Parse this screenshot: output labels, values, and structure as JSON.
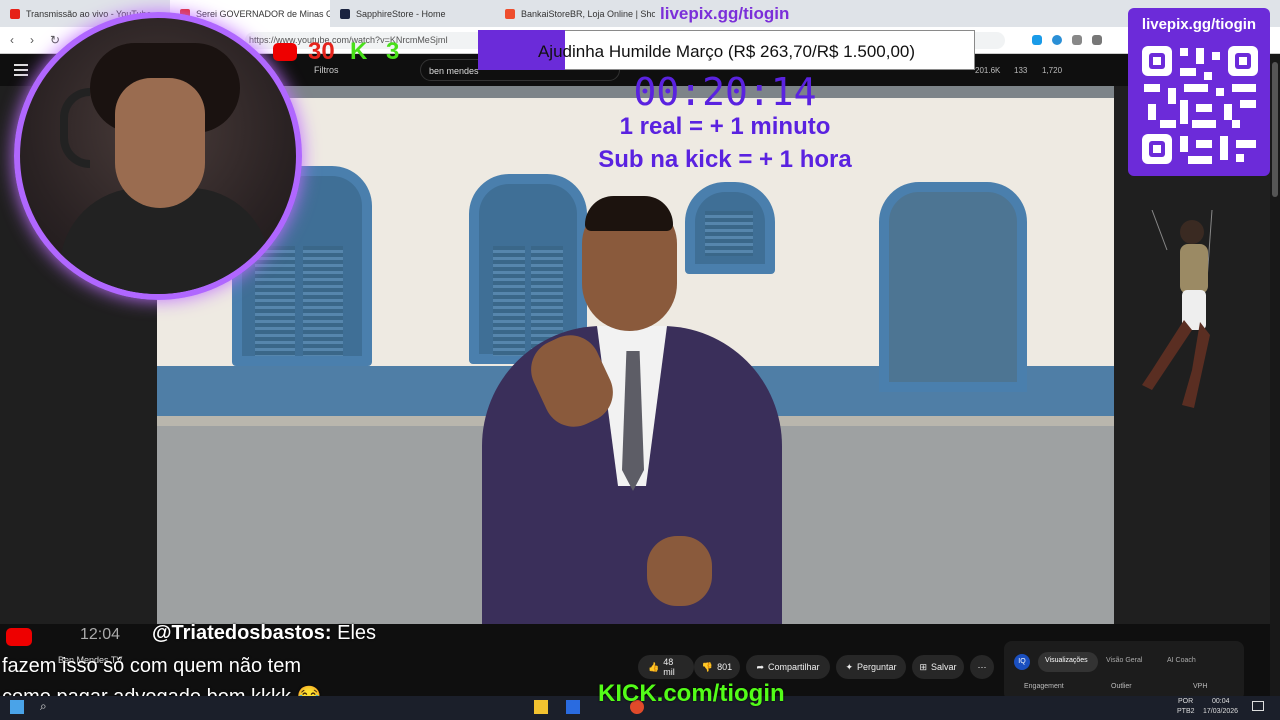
{
  "browser": {
    "tabs": [
      {
        "label": "Transmissão ao vivo - YouTube",
        "color": "#e62117"
      },
      {
        "label": "Serei GOVERNADOR de Minas G",
        "color": "#e62117",
        "active": true
      },
      {
        "label": "SapphireStore - Home",
        "color": "#1a2340"
      },
      {
        "label": "BankaiStoreBR, Loja Online | Shopee",
        "color": "#ee4d2d"
      }
    ],
    "tab_close": "×",
    "url": "https://www.youtube.com/watch?v=KNrcmMeSjmI"
  },
  "youtube": {
    "filters_label": "Filtros",
    "search_value": "ben mendes",
    "stats": [
      "201.6K",
      "133",
      "1,720"
    ]
  },
  "overlay": {
    "livepix_top": "livepix.gg/tiogin",
    "goal_text": "Ajudinha Humilde Março (R$ 263,70/R$ 1.500,00)",
    "goal_progress": 0.1758,
    "timer": "00:20:14",
    "rule1": "1 real = + 1 minuto",
    "rule2": "Sub na kick = + 1 hora",
    "qr_title": "livepix.gg/tiogin",
    "yt_count": "30",
    "kick_icon": "K",
    "kick_count": "3",
    "kick_banner": "KICK.com/tiogin"
  },
  "video_meta": {
    "time": "12:04",
    "channel_partial": "Ben Mendes TV",
    "likes": "48 mil",
    "dislikes": "801",
    "share": "Compartilhar",
    "ask": "Perguntar",
    "save": "Salvar",
    "more": "⋯"
  },
  "chat": {
    "name": "@Triatedosbastos:",
    "line1_end": "Eles",
    "line2": "fazem isso só com quem não tem",
    "line3": "como pagar advogado bom kkkk 😂"
  },
  "iq": {
    "badge": "IQ",
    "tabs": [
      "Visualizações",
      "Visão Geral",
      "AI Coach"
    ],
    "subs": [
      "Engagement",
      "Outlier",
      "VPH"
    ]
  },
  "taskbar": {
    "lang": "POR",
    "layout": "PTB2",
    "time": "00:04",
    "date": "17/03/2026"
  }
}
